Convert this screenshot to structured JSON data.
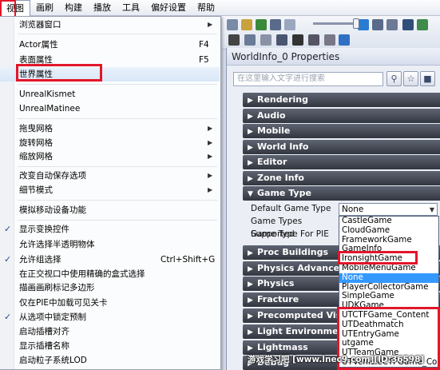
{
  "menubar": {
    "items": [
      "视图",
      "画刷",
      "构建",
      "播放",
      "工具",
      "偏好设置",
      "帮助"
    ]
  },
  "context_menu": {
    "items": [
      {
        "label": "浏览器窗口",
        "submenu": true
      },
      {
        "label": "Actor属性",
        "shortcut": "F4"
      },
      {
        "label": "表面属性",
        "shortcut": "F5"
      },
      {
        "label": "世界属性"
      },
      {
        "label": "UnrealKismet"
      },
      {
        "label": "UnrealMatinee"
      },
      {
        "label": "拖曳网格",
        "submenu": true
      },
      {
        "label": "旋转网格",
        "submenu": true
      },
      {
        "label": "缩放网格",
        "submenu": true
      },
      {
        "label": "改变自动保存选项",
        "submenu": true
      },
      {
        "label": "细节模式",
        "submenu": true
      },
      {
        "label": "模拟移动设备功能"
      },
      {
        "label": "显示变换控件",
        "checked": true
      },
      {
        "label": "允许选择半透明物体"
      },
      {
        "label": "允许组选择",
        "shortcut": "Ctrl+Shift+G",
        "checked": true
      },
      {
        "label": "在正交视口中使用精确的盒式选择"
      },
      {
        "label": "描画画刷标记多边形"
      },
      {
        "label": "仅在PIE中加载可见关卡"
      },
      {
        "label": "从选项中锁定预制",
        "checked": true
      },
      {
        "label": "启动插槽对齐"
      },
      {
        "label": "显示插槽名称"
      },
      {
        "label": "启动粒子系统LOD"
      }
    ],
    "submenu_glyph": "▶",
    "check_glyph": "✓"
  },
  "properties": {
    "title": "WorldInfo_0 Properties",
    "search_placeholder": "在这里输入文字进行搜索",
    "categories_top": [
      "Rendering",
      "Audio",
      "Mobile",
      "World Info",
      "Editor",
      "Zone Info",
      "Game Type"
    ],
    "game_type_props": [
      "Default Game Type",
      "Game Types Supported",
      "Game Type For PIE"
    ],
    "categories_bottom": [
      "Proc Buildings",
      "Physics Advanced",
      "Physics",
      "Fracture",
      "Precomputed Visibil",
      "Light Environment",
      "Lightmass",
      "Debug"
    ],
    "collapsed_arrow": "▶",
    "expanded_arrow": "▼"
  },
  "game_type_dropdown": {
    "selected_value": "None",
    "options": [
      "CastleGame",
      "CloudGame",
      "FrameworkGame",
      "GameInfo",
      "IronsightGame",
      "MobileMenuGame",
      "None",
      "PlayerCollectorGame",
      "SimpleGame",
      "UDKGame",
      "UTCTFGame_Content",
      "UTDeathmatch",
      "UTEntryGame",
      "utgame",
      "UTTeamGame",
      "UTVehicleCTFGame_Cont"
    ],
    "highlighted": "None"
  },
  "watermark": "游戏学习吧 [www.lnec9.com][ID:36598]"
}
